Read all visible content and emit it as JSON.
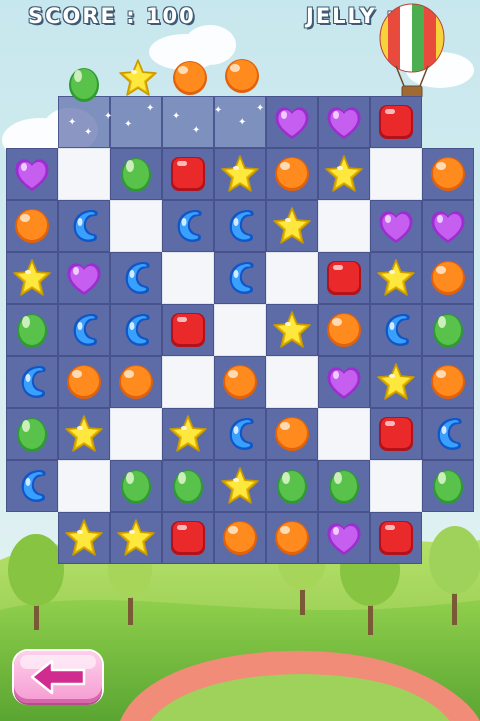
{
  "hud": {
    "score_text": "SCORE : 100",
    "jelly_text": "JELLY : 0"
  },
  "colors": {
    "sky": "#bfe2ea",
    "board_tile": "#5d6ba6",
    "jelly_clear_tile": "#f4f6f9",
    "grass_light": "#9fd25a",
    "grass_dark": "#69b13b",
    "path": "#f08c78"
  },
  "icons": {
    "back": "back-arrow-icon",
    "balloon": "hot-air-balloon-icon"
  },
  "candy_types": {
    "G": "green-bean",
    "Y": "yellow-star",
    "O": "orange-ball",
    "P": "purple-heart",
    "R": "red-square",
    "B": "blue-jellybean"
  },
  "incoming_row": [
    "G",
    "Y",
    "O",
    "O"
  ],
  "grid": [
    [
      "-",
      "-",
      "-",
      "-",
      "-",
      "P",
      "P",
      "R",
      "-"
    ],
    [
      "P",
      "",
      "G",
      "R",
      "Y",
      "O",
      "Y",
      "",
      "O"
    ],
    [
      "O",
      "B",
      "",
      "B",
      "B",
      "Y",
      "",
      "P",
      "P"
    ],
    [
      "Y",
      "P",
      "B",
      "",
      "B",
      "",
      "R",
      "Y",
      "O"
    ],
    [
      "G",
      "B",
      "B",
      "R",
      "",
      "Y",
      "O",
      "B",
      "G"
    ],
    [
      "B",
      "O",
      "O",
      "",
      "O",
      "",
      "P",
      "Y",
      "O"
    ],
    [
      "G",
      "Y",
      "",
      "Y",
      "B",
      "O",
      "",
      "R",
      "B"
    ],
    [
      "B",
      "",
      "G",
      "G",
      "Y",
      "G",
      "G",
      "",
      "G"
    ],
    [
      "-",
      "Y",
      "Y",
      "R",
      "O",
      "O",
      "P",
      "R",
      "-"
    ]
  ],
  "clear_cells": [
    [
      1,
      1
    ],
    [
      1,
      7
    ],
    [
      2,
      2
    ],
    [
      2,
      6
    ],
    [
      3,
      3
    ],
    [
      3,
      5
    ],
    [
      4,
      4
    ],
    [
      5,
      3
    ],
    [
      5,
      5
    ],
    [
      6,
      2
    ],
    [
      6,
      6
    ],
    [
      7,
      1
    ],
    [
      7,
      7
    ]
  ]
}
